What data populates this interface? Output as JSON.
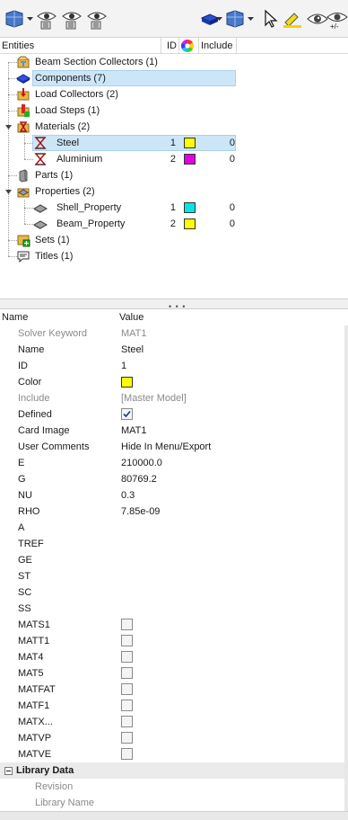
{
  "toolbar": {
    "icons": [
      "entity-view-icon",
      "show-icon",
      "hide-icon",
      "isolate-icon",
      "solid-cube-icon",
      "entity-view-dropdown-icon",
      "cursor-icon",
      "highlight-icon",
      "eye-icon",
      "eye-plus-minus-icon"
    ]
  },
  "tree": {
    "columns": {
      "entities": "Entities",
      "id": "ID",
      "include": "Include"
    },
    "rows": [
      {
        "label": "Beam Section Collectors (1)",
        "icon": "beam-section-collector-icon",
        "level": 0
      },
      {
        "label": "Components (7)",
        "icon": "component-icon",
        "level": 0,
        "selected": true
      },
      {
        "label": "Load Collectors (2)",
        "icon": "load-collector-icon",
        "level": 0
      },
      {
        "label": "Load Steps (1)",
        "icon": "load-step-icon",
        "level": 0
      },
      {
        "label": "Materials (2)",
        "icon": "materials-icon",
        "level": 0,
        "expanded": true
      },
      {
        "label": "Steel",
        "icon": "material-icon",
        "level": 1,
        "id": "1",
        "color": "#ffff00",
        "include": "0",
        "highlighted": true
      },
      {
        "label": "Aluminium",
        "icon": "material-icon",
        "level": 1,
        "id": "2",
        "color": "#e000e0",
        "include": "0"
      },
      {
        "label": "Parts (1)",
        "icon": "part-icon",
        "level": 0
      },
      {
        "label": "Properties (2)",
        "icon": "properties-icon",
        "level": 0,
        "expanded": true
      },
      {
        "label": "Shell_Property",
        "icon": "property-icon",
        "level": 1,
        "id": "1",
        "color": "#00e6e6",
        "include": "0"
      },
      {
        "label": "Beam_Property",
        "icon": "property-icon",
        "level": 1,
        "id": "2",
        "color": "#ffff00",
        "include": "0"
      },
      {
        "label": "Sets (1)",
        "icon": "set-icon",
        "level": 0
      },
      {
        "label": "Titles (1)",
        "icon": "title-icon",
        "level": 0
      }
    ]
  },
  "splitter": {
    "grip": "• • •"
  },
  "properties": {
    "columns": {
      "name": "Name",
      "value": "Value"
    },
    "rows": [
      {
        "name": "Solver Keyword",
        "value": "MAT1",
        "grey": true
      },
      {
        "name": "Name",
        "value": "Steel"
      },
      {
        "name": "ID",
        "value": "1"
      },
      {
        "name": "Color",
        "type": "swatch",
        "color": "#ffff00"
      },
      {
        "name": "Include",
        "value": "[Master Model]",
        "grey": true
      },
      {
        "name": "Defined",
        "type": "checkbox",
        "checked": true
      },
      {
        "name": "Card Image",
        "value": "MAT1"
      },
      {
        "name": "User Comments",
        "value": "Hide In Menu/Export"
      },
      {
        "name": "E",
        "value": "210000.0"
      },
      {
        "name": "G",
        "value": "80769.2"
      },
      {
        "name": "NU",
        "value": "0.3"
      },
      {
        "name": "RHO",
        "value": "7.85e-09"
      },
      {
        "name": "A",
        "value": ""
      },
      {
        "name": "TREF",
        "value": ""
      },
      {
        "name": "GE",
        "value": ""
      },
      {
        "name": "ST",
        "value": ""
      },
      {
        "name": "SC",
        "value": ""
      },
      {
        "name": "SS",
        "value": ""
      },
      {
        "name": "MATS1",
        "type": "checkbox",
        "checked": false
      },
      {
        "name": "MATT1",
        "type": "checkbox",
        "checked": false
      },
      {
        "name": "MAT4",
        "type": "checkbox",
        "checked": false
      },
      {
        "name": "MAT5",
        "type": "checkbox",
        "checked": false
      },
      {
        "name": "MATFAT",
        "type": "checkbox",
        "checked": false
      },
      {
        "name": "MATF1",
        "type": "checkbox",
        "checked": false
      },
      {
        "name": "MATX...",
        "type": "checkbox",
        "checked": false
      },
      {
        "name": "MATVP",
        "type": "checkbox",
        "checked": false
      },
      {
        "name": "MATVE",
        "type": "checkbox",
        "checked": false
      }
    ],
    "library": {
      "title": "Library Data",
      "items": [
        "Revision",
        "Library Name"
      ]
    }
  }
}
